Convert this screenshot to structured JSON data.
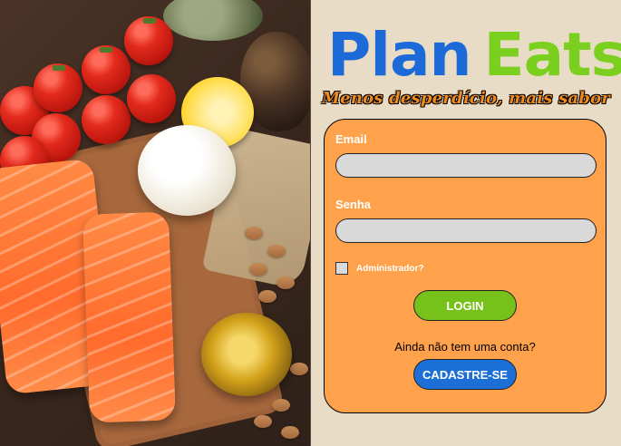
{
  "app": {
    "logo_part1": "Plan",
    "logo_part2": "Eats",
    "tagline": "Menos desperdício, mais sabor"
  },
  "login_form": {
    "email_label": "Email",
    "email_value": "",
    "password_label": "Senha",
    "password_value": "",
    "admin_checkbox_label": "Administrador?",
    "admin_checked": false,
    "login_button": "LOGIN",
    "no_account_text": "Ainda não tem uma conta?",
    "signup_button": "CADASTRE-SE"
  },
  "colors": {
    "logo_blue": "#1c6ad8",
    "logo_green": "#7bd01f",
    "card_orange": "#ffa24b",
    "login_green": "#76c11a",
    "signup_blue": "#1d6fd8",
    "background": "#e9dcc6"
  },
  "hero_image": {
    "description_icon": "food-photo"
  }
}
